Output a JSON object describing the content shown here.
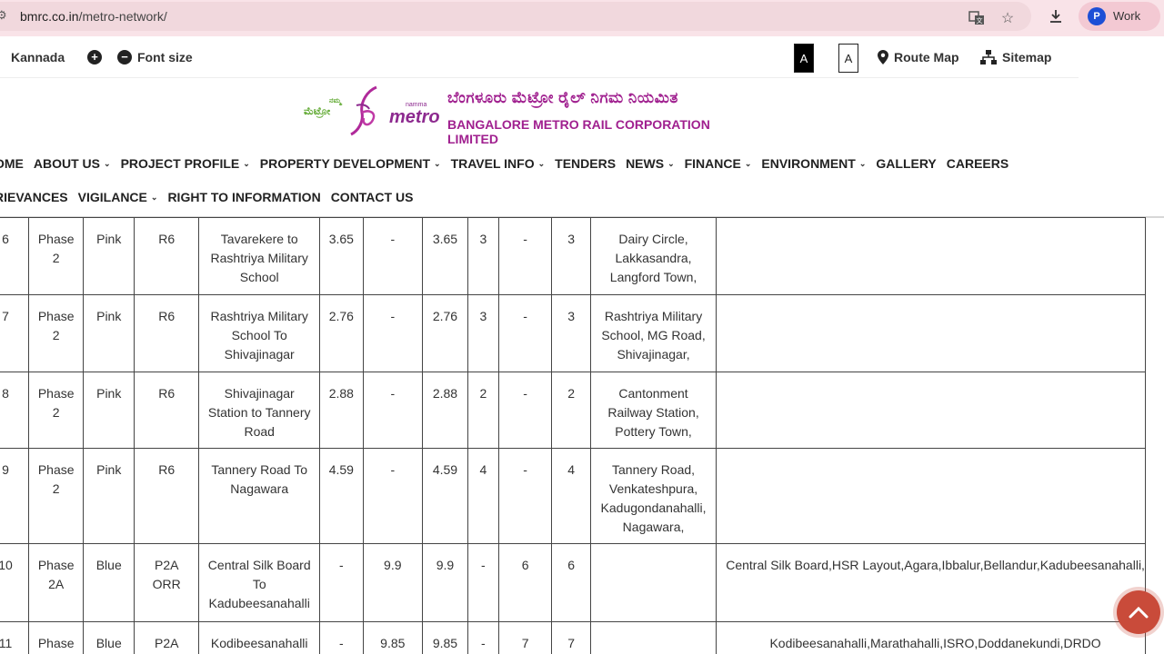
{
  "browser": {
    "url_host": "bmrc.co.in",
    "url_path": "/metro-network/",
    "profile_initial": "P",
    "profile_label": "Work"
  },
  "utility": {
    "kannada": "Kannada",
    "font_size": "Font size",
    "a_dark": "A",
    "a_light": "A",
    "route_map": "Route Map",
    "sitemap": "Sitemap"
  },
  "logo": {
    "kn_small_1": "ನಮ್ಮ",
    "kn_small_2": "ಮೆಟ್ರೋ",
    "namma": "namma",
    "metro": "metro",
    "kn_title": "ಬೆಂಗಳೂರು ಮೆಟ್ರೋ ರೈಲ್ ನಿಗಮ ನಿಯಮಿತ",
    "en_title": "BANGALORE METRO RAIL CORPORATION LIMITED"
  },
  "nav": {
    "row1": [
      {
        "label": "OME",
        "dropdown": false
      },
      {
        "label": "ABOUT US",
        "dropdown": true
      },
      {
        "label": "PROJECT PROFILE",
        "dropdown": true
      },
      {
        "label": "PROPERTY DEVELOPMENT",
        "dropdown": true
      },
      {
        "label": "TRAVEL INFO",
        "dropdown": true
      },
      {
        "label": "TENDERS",
        "dropdown": false
      },
      {
        "label": "NEWS",
        "dropdown": true
      },
      {
        "label": "FINANCE",
        "dropdown": true
      },
      {
        "label": "ENVIRONMENT",
        "dropdown": true
      },
      {
        "label": "GALLERY",
        "dropdown": false
      },
      {
        "label": "CAREERS",
        "dropdown": false
      }
    ],
    "row2": [
      {
        "label": "RIEVANCES",
        "dropdown": false
      },
      {
        "label": "VIGILANCE",
        "dropdown": true
      },
      {
        "label": "RIGHT TO INFORMATION",
        "dropdown": false
      },
      {
        "label": "CONTACT US",
        "dropdown": false
      }
    ]
  },
  "table": {
    "rows": [
      {
        "no": "6",
        "phase": "Phase 2",
        "line": "Pink",
        "reach": "R6",
        "section": "Tavarekere to Rashtriya Military School",
        "elevated": "3.65",
        "underground": "-",
        "total": "3.65",
        "st_elev": "3",
        "st_ug": "-",
        "st_total": "3",
        "stations_a": "Dairy Circle, Lakkasandra, Langford Town,",
        "stations_b": ""
      },
      {
        "no": "7",
        "phase": "Phase 2",
        "line": "Pink",
        "reach": "R6",
        "section": "Rashtriya Military School To Shivajinagar",
        "elevated": "2.76",
        "underground": "-",
        "total": "2.76",
        "st_elev": "3",
        "st_ug": "-",
        "st_total": "3",
        "stations_a": "Rashtriya Military School, MG Road, Shivajinagar,",
        "stations_b": ""
      },
      {
        "no": "8",
        "phase": "Phase 2",
        "line": "Pink",
        "reach": "R6",
        "section": "Shivajinagar Station to Tannery Road",
        "elevated": "2.88",
        "underground": "-",
        "total": "2.88",
        "st_elev": "2",
        "st_ug": "-",
        "st_total": "2",
        "stations_a": "Cantonment Railway Station, Pottery Town,",
        "stations_b": ""
      },
      {
        "no": "9",
        "phase": "Phase 2",
        "line": "Pink",
        "reach": "R6",
        "section": "Tannery Road To Nagawara",
        "elevated": "4.59",
        "underground": "-",
        "total": "4.59",
        "st_elev": "4",
        "st_ug": "-",
        "st_total": "4",
        "stations_a": "Tannery Road, Venkateshpura, Kadugondanahalli, Nagawara,",
        "stations_b": ""
      },
      {
        "no": "10",
        "phase": "Phase 2A",
        "line": "Blue",
        "reach": "P2A ORR",
        "section": "Central Silk Board To Kadubeesanahalli",
        "elevated": "-",
        "underground": "9.9",
        "total": "9.9",
        "st_elev": "-",
        "st_ug": "6",
        "st_total": "6",
        "stations_a": "",
        "stations_b": "Central Silk Board,HSR Layout,Agara,Ibbalur,Bellandur,Kadubeesanahalli,"
      },
      {
        "no": "11",
        "phase": "Phase",
        "line": "Blue",
        "reach": "P2A ORR",
        "section": "Kodibeesanahalli",
        "elevated": "-",
        "underground": "9.85",
        "total": "9.85",
        "st_elev": "-",
        "st_ug": "7",
        "st_total": "7",
        "stations_a": "",
        "stations_b": "Kodibeesanahalli,Marathahalli,ISRO,Doddanekundi,DRDO"
      }
    ]
  }
}
